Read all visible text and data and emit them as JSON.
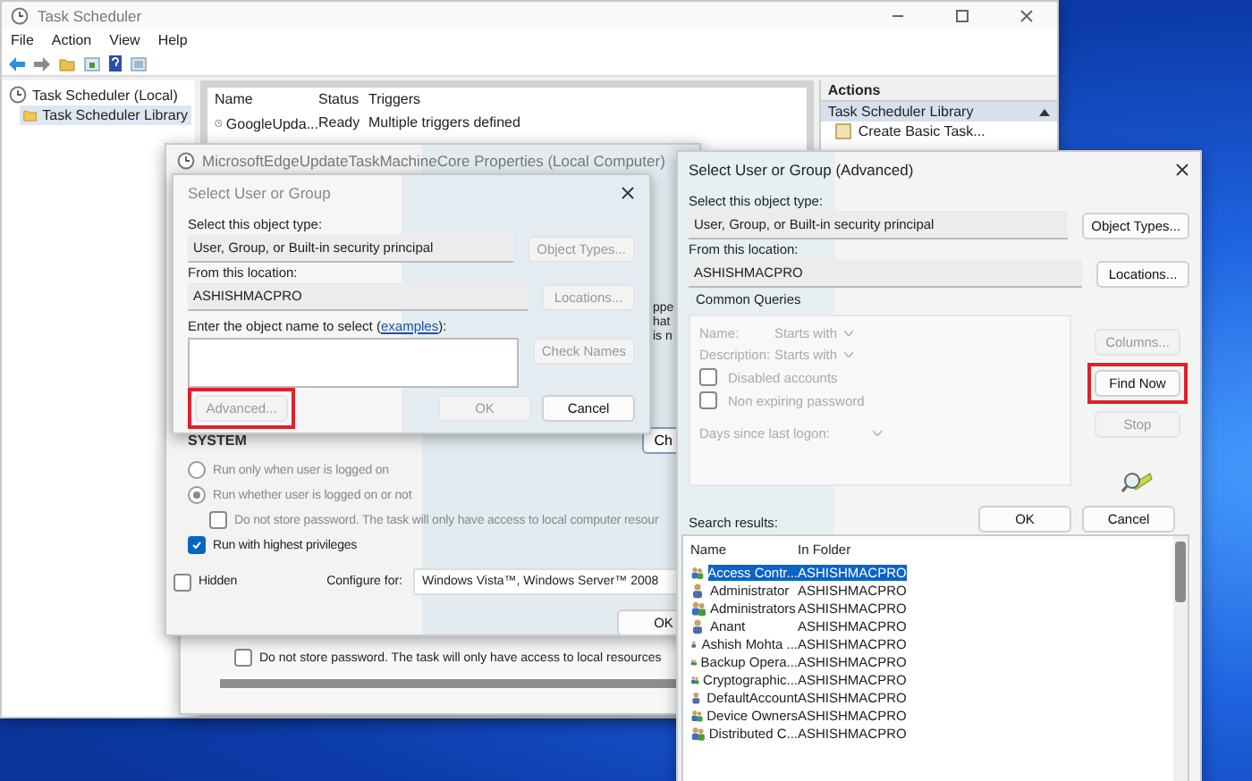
{
  "main_window": {
    "title": "Task Scheduler",
    "menu": [
      "File",
      "Action",
      "View",
      "Help"
    ],
    "tree": [
      {
        "label": "Task Scheduler (Local)",
        "selected": false,
        "children": [
          {
            "label": "Task Scheduler Library",
            "selected": true
          }
        ]
      }
    ],
    "task_list": {
      "columns": [
        "Name",
        "Status",
        "Triggers"
      ],
      "rows": [
        [
          "GoogleUpda...",
          "Ready",
          "Multiple triggers defined"
        ]
      ]
    },
    "actions": {
      "title": "Actions",
      "section": "Task Scheduler Library",
      "items": [
        "Create Basic Task..."
      ]
    }
  },
  "back_dialog": {
    "checkbox": {
      "label": "Do not store password.  The task will only have access to local resources",
      "checked": false
    }
  },
  "properties_dialog": {
    "title": "MicrosoftEdgeUpdateTaskMachineCore Properties (Local Computer)",
    "cut_texts": [
      "ppe",
      "hat",
      "is n"
    ],
    "account": "SYSTEM",
    "change_button": "Ch",
    "options": [
      {
        "kind": "radio",
        "label": "Run only when user is logged on",
        "checked": false,
        "disabled": true,
        "indented": false
      },
      {
        "kind": "radio",
        "label": "Run whether user is logged on or not",
        "checked": true,
        "disabled": true,
        "indented": false
      },
      {
        "kind": "checkbox",
        "label": "Do not store password.  The task will only have access to local computer resour",
        "checked": false,
        "disabled": true,
        "indented": true
      },
      {
        "kind": "checkbox",
        "label": "Run with highest privileges",
        "checked": true,
        "disabled": false,
        "indented": false
      }
    ],
    "hidden": {
      "label": "Hidden",
      "checked": false
    },
    "configure_label": "Configure for:",
    "configure_value": "Windows Vista™, Windows Server™ 2008",
    "ok_button": "OK"
  },
  "select_dialog": {
    "title": "Select User or Group",
    "object_type_label": "Select this object type:",
    "object_type": "User, Group, or Built-in security principal",
    "object_types_button": {
      "label": "Object Types...",
      "disabled": true,
      "highlighted": false
    },
    "location_label": "From this location:",
    "location": "ASHISHMACPRO",
    "locations_button": {
      "label": "Locations...",
      "disabled": true,
      "highlighted": false
    },
    "prompt": "Enter the object name to select (",
    "prompt_link": "examples",
    "prompt_end": "):",
    "check_names_button": {
      "label": "Check Names",
      "disabled": true,
      "highlighted": false
    },
    "advanced_button": {
      "label": "Advanced...",
      "disabled": true,
      "highlighted": true
    },
    "ok_button": {
      "label": "OK",
      "disabled": true,
      "highlighted": false
    },
    "cancel_button": {
      "label": "Cancel",
      "disabled": false,
      "highlighted": false
    }
  },
  "advanced_dialog": {
    "title": "Select User or Group (Advanced)",
    "object_type_label": "Select this object type:",
    "object_type": "User, Group, or Built-in security principal",
    "object_types_button": {
      "label": "Object Types...",
      "disabled": false,
      "highlighted": false
    },
    "location_label": "From this location:",
    "location": "ASHISHMACPRO",
    "locations_button": {
      "label": "Locations...",
      "disabled": false,
      "highlighted": false
    },
    "queries": {
      "tab": "Common Queries",
      "name_label": "Name:",
      "name_mode": "Starts with",
      "description_label": "Description:",
      "description_mode": "Starts with",
      "checkboxes": [
        {
          "label": "Disabled accounts",
          "checked": false
        },
        {
          "label": "Non expiring password",
          "checked": false
        }
      ],
      "days_label": "Days since last logon:"
    },
    "columns_button": {
      "label": "Columns...",
      "disabled": true,
      "highlighted": false
    },
    "find_now_button": {
      "label": "Find Now",
      "disabled": false,
      "highlighted": true
    },
    "stop_button": {
      "label": "Stop",
      "disabled": true,
      "highlighted": false
    },
    "ok_button": {
      "label": "OK",
      "disabled": false,
      "highlighted": false
    },
    "cancel_button": {
      "label": "Cancel",
      "disabled": false,
      "highlighted": false
    },
    "results_label": "Search results:",
    "result_columns": [
      "Name",
      "In Folder"
    ],
    "results": [
      {
        "name": "Access Contr...",
        "folder": "ASHISHMACPRO",
        "kind": "group",
        "selected": true
      },
      {
        "name": "Administrator",
        "folder": "ASHISHMACPRO",
        "kind": "user",
        "selected": false
      },
      {
        "name": "Administrators",
        "folder": "ASHISHMACPRO",
        "kind": "group",
        "selected": false
      },
      {
        "name": "Anant",
        "folder": "ASHISHMACPRO",
        "kind": "user",
        "selected": false
      },
      {
        "name": "Ashish Mohta ...",
        "folder": "ASHISHMACPRO",
        "kind": "user",
        "selected": false
      },
      {
        "name": "Backup Opera...",
        "folder": "ASHISHMACPRO",
        "kind": "group",
        "selected": false
      },
      {
        "name": "Cryptographic...",
        "folder": "ASHISHMACPRO",
        "kind": "group",
        "selected": false
      },
      {
        "name": "DefaultAccount",
        "folder": "ASHISHMACPRO",
        "kind": "user",
        "selected": false
      },
      {
        "name": "Device Owners",
        "folder": "ASHISHMACPRO",
        "kind": "group",
        "selected": false
      },
      {
        "name": "Distributed C...",
        "folder": "ASHISHMACPRO",
        "kind": "group",
        "selected": false
      }
    ]
  }
}
